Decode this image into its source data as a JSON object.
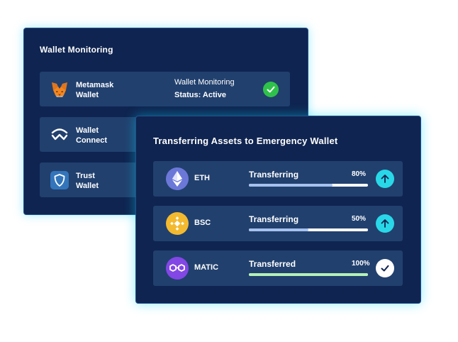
{
  "monitoring": {
    "title": "Wallet Monitoring",
    "wallets": [
      {
        "name": "Metamask\nWallet",
        "icon": "metamask-fox-icon",
        "status_label": "Wallet Monitoring",
        "status_value": "Status: Active",
        "check_icon": "check-icon"
      },
      {
        "name": "Wallet\nConnect",
        "icon": "walletconnect-icon"
      },
      {
        "name": "Trust\nWallet",
        "icon": "trust-shield-icon"
      }
    ]
  },
  "transfer": {
    "title": "Transferring Assets to Emergency Wallet",
    "assets": [
      {
        "symbol": "ETH",
        "status": "Transferring",
        "percent_label": "80%",
        "progress": 0.7,
        "icon": "ethereum-icon",
        "action_icon": "arrow-up-icon"
      },
      {
        "symbol": "BSC",
        "status": "Transferring",
        "percent_label": "50%",
        "progress": 0.5,
        "icon": "binance-icon",
        "action_icon": "arrow-up-icon"
      },
      {
        "symbol": "MATIC",
        "status": "Transferred",
        "percent_label": "100%",
        "progress": 1.0,
        "icon": "polygon-icon",
        "action_icon": "check-icon"
      }
    ]
  },
  "colors": {
    "panel": "#0f2450",
    "row": "#21406e",
    "accent_cyan": "#29d8e8",
    "success_green": "#2fc24a",
    "eth": "#6c78d8",
    "bnb": "#f3ba2f",
    "matic": "#8247e5"
  }
}
